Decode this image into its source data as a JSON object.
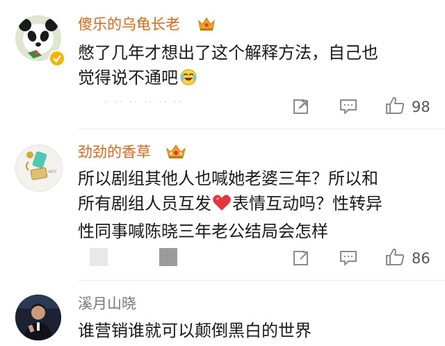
{
  "comments": [
    {
      "username": "傻乐的乌龟长老",
      "text_line1": "憋了几年才想出了这个解释方法，自己也",
      "text_line2": "觉得说不通吧",
      "faded_meta": "· ·· ·· ·· ·· ··",
      "like_count": "98"
    },
    {
      "username": "劲劲的香草",
      "text_line1": "所以剧组其他人也喊她老婆三年？所以和",
      "text_line2a": "所有剧组人员互发",
      "text_line2b": "表情互动吗？性转异",
      "text_line3": "性同事喊陈晓三年老公结局会怎样",
      "like_count": "86"
    },
    {
      "username": "溪月山晓",
      "text_line1": "谁营销谁就可以颠倒黑白的世界"
    }
  ],
  "colors": {
    "vip_username": "#e8650f",
    "normal_username": "#7a7a7a",
    "icon_gray": "#8a8a8a",
    "heart": "#e8323c",
    "crown_gold": "#f0a020"
  }
}
